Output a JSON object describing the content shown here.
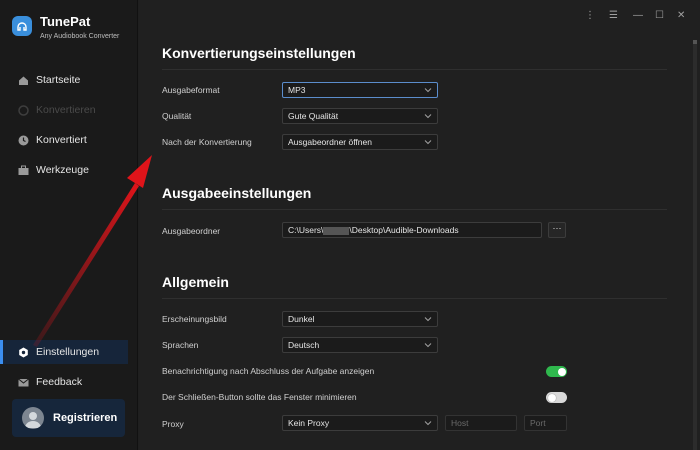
{
  "app": {
    "name": "TunePat",
    "subtitle": "Any Audiobook Converter"
  },
  "sidebar": {
    "items": [
      {
        "label": "Startseite",
        "icon": "home-icon",
        "state": "normal"
      },
      {
        "label": "Konvertieren",
        "icon": "convert-icon",
        "state": "disabled"
      },
      {
        "label": "Konvertiert",
        "icon": "clock-icon",
        "state": "normal"
      },
      {
        "label": "Werkzeuge",
        "icon": "toolbox-icon",
        "state": "normal"
      }
    ],
    "bottom_items": [
      {
        "label": "Einstellungen",
        "icon": "gear-icon",
        "state": "active"
      },
      {
        "label": "Feedback",
        "icon": "mail-icon",
        "state": "normal"
      }
    ],
    "register_label": "Registrieren"
  },
  "window_controls": [
    "⋮",
    "☰",
    "—",
    "☐",
    "✕"
  ],
  "sections": {
    "conversion": {
      "title": "Konvertierungseinstellungen",
      "rows": [
        {
          "label": "Ausgabeformat",
          "value": "MP3"
        },
        {
          "label": "Qualität",
          "value": "Gute Qualität"
        },
        {
          "label": "Nach der Konvertierung",
          "value": "Ausgabeordner öffnen"
        }
      ]
    },
    "output": {
      "title": "Ausgabeeinstellungen",
      "folder_label": "Ausgabeordner",
      "folder_prefix": "C:\\Users\\",
      "folder_suffix": "\\Desktop\\Audible-Downloads",
      "browse_label": "···"
    },
    "general": {
      "title": "Allgemein",
      "rows": [
        {
          "label": "Erscheinungsbild",
          "value": "Dunkel"
        },
        {
          "label": "Sprachen",
          "value": "Deutsch"
        }
      ],
      "toggles": [
        {
          "label": "Benachrichtigung nach Abschluss der Aufgabe anzeigen",
          "on": true
        },
        {
          "label": "Der Schließen-Button sollte das Fenster minimieren",
          "on": false
        }
      ],
      "proxy": {
        "label": "Proxy",
        "value": "Kein Proxy",
        "host_placeholder": "Host",
        "port_placeholder": "Port"
      }
    }
  },
  "colors": {
    "accent": "#3b8ef0",
    "toggle_on": "#2fb84d",
    "annotation_arrow": "#e0141a"
  }
}
